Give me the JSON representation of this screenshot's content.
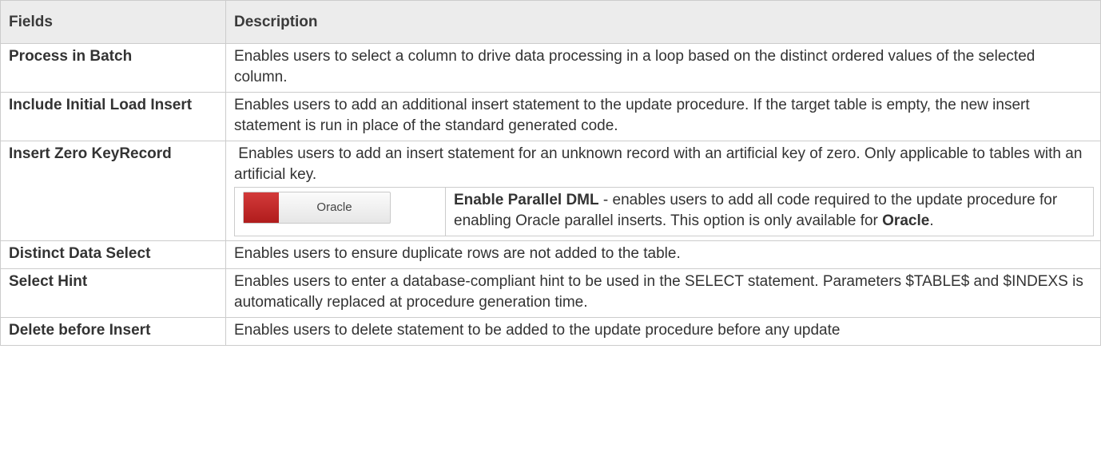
{
  "header": {
    "col1": "Fields",
    "col2": "Description"
  },
  "rows": [
    {
      "field": "Process in Batch",
      "desc": "Enables users to select a column to drive data processing in a loop based on the distinct ordered values of the selected column."
    },
    {
      "field": "Include Initial Load Insert",
      "desc": "Enables users to add an additional insert statement to the update procedure. If the target table is empty, the new insert statement is run in place of the standard generated code."
    },
    {
      "field": "Insert Zero KeyRecord",
      "desc": " Enables users to add an insert statement for an unknown record with an artificial key of zero. Only applicable to tables with an artificial key."
    },
    {
      "field": "Distinct Data Select",
      "desc": "Enables users to ensure duplicate rows are not added to the table."
    },
    {
      "field": "Select Hint",
      "desc": "Enables users to enter a database-compliant hint to be used in the SELECT statement. Parameters $TABLE$ and $INDEXS is automatically replaced at procedure generation time."
    },
    {
      "field": "Delete before Insert",
      "desc": "Enables users to delete statement to be added to the update procedure before any update"
    }
  ],
  "oracle_note": {
    "badge_label": "Oracle",
    "badge_color": "#c0282d",
    "title": "Enable Parallel DML",
    "text": " - enables users to add all code required to the update procedure for enabling Oracle parallel inserts. This option is only available for ",
    "platform": "Oracle",
    "end": "."
  }
}
